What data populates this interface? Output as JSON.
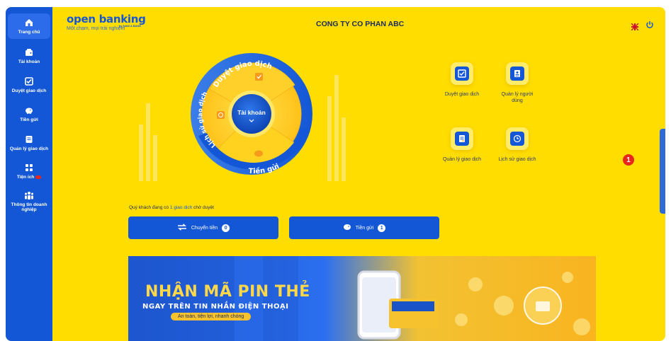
{
  "sidebar": {
    "items": [
      {
        "label": "Trang chủ",
        "icon": "home-icon",
        "active": true
      },
      {
        "label": "Tài khoản",
        "icon": "wallet-icon"
      },
      {
        "label": "Duyệt giao dịch",
        "icon": "checklist-icon"
      },
      {
        "label": "Tiền gửi",
        "icon": "piggy-bank-icon"
      },
      {
        "label": "Quản lý giao dịch",
        "icon": "document-icon"
      },
      {
        "label": "Tiện ích",
        "icon": "grid-icon",
        "badge": "new"
      },
      {
        "label": "Thông tin doanh nghiệp",
        "icon": "users-icon"
      }
    ]
  },
  "header": {
    "logo_title": "open banking",
    "logo_by": "by NAM A BANK",
    "tagline": "Một chạm, mọi trải nghiệm",
    "company": "CONG TY CO PHAN ABC"
  },
  "wheel": {
    "top_label": "Duyệt giao dịch",
    "left_label": "Lịch sử giao dịch",
    "bottom_label": "Tiền gửi",
    "center_label": "Tài khoản"
  },
  "quick_actions": [
    {
      "label": "Duyệt giao dịch",
      "icon": "checklist-icon"
    },
    {
      "label": "Quản lý người dùng",
      "icon": "user-card-icon"
    },
    {
      "label": "Quản lý giao dịch",
      "icon": "document-icon"
    },
    {
      "label": "Lịch sử giao dịch",
      "icon": "clock-icon"
    }
  ],
  "notice": {
    "prefix": "Quý khách đang có",
    "link": "1 giao dịch",
    "suffix": "chờ duyệt"
  },
  "buttons": {
    "transfer_label": "Chuyển tiền",
    "transfer_count": "0",
    "deposit_label": "Tiền gửi",
    "deposit_count": "1"
  },
  "banner": {
    "line1": "NHẬN MÃ PIN THẺ",
    "line2": "NGAY TRÊN TIN NHẮN ĐIỆN THOẠI",
    "line3": "An toàn, tiện lợi, nhanh chóng"
  },
  "notification_count": "1",
  "colors": {
    "primary": "#1457d6",
    "background": "#ffdd00",
    "accent": "#f59a1b",
    "alert": "#e8261b"
  }
}
